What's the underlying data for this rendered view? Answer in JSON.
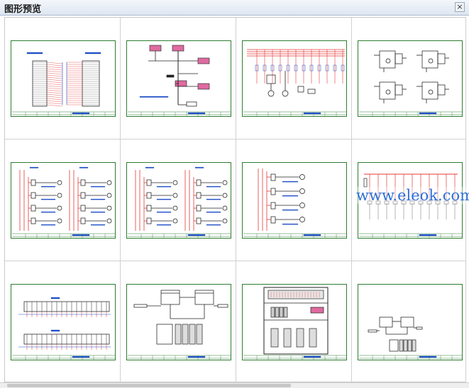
{
  "window": {
    "title": "图形预览",
    "close_glyph": "×"
  },
  "watermark": "www.eleok.com",
  "colors": {
    "sheet_border": "#2e7d32",
    "wire_red": "#e53935",
    "wire_blue": "#1e4fc8",
    "component_black": "#111111",
    "pink": "#e06aa0"
  },
  "thumbnails": [
    {
      "kind": "io-table"
    },
    {
      "kind": "block-diagram"
    },
    {
      "kind": "power-distribution"
    },
    {
      "kind": "relay-circuits"
    },
    {
      "kind": "motor-outputs-double"
    },
    {
      "kind": "motor-outputs-double"
    },
    {
      "kind": "motor-outputs-single"
    },
    {
      "kind": "bus-outputs"
    },
    {
      "kind": "terminal-strip"
    },
    {
      "kind": "network-topology"
    },
    {
      "kind": "cabinet-layout"
    },
    {
      "kind": "network-small"
    }
  ]
}
